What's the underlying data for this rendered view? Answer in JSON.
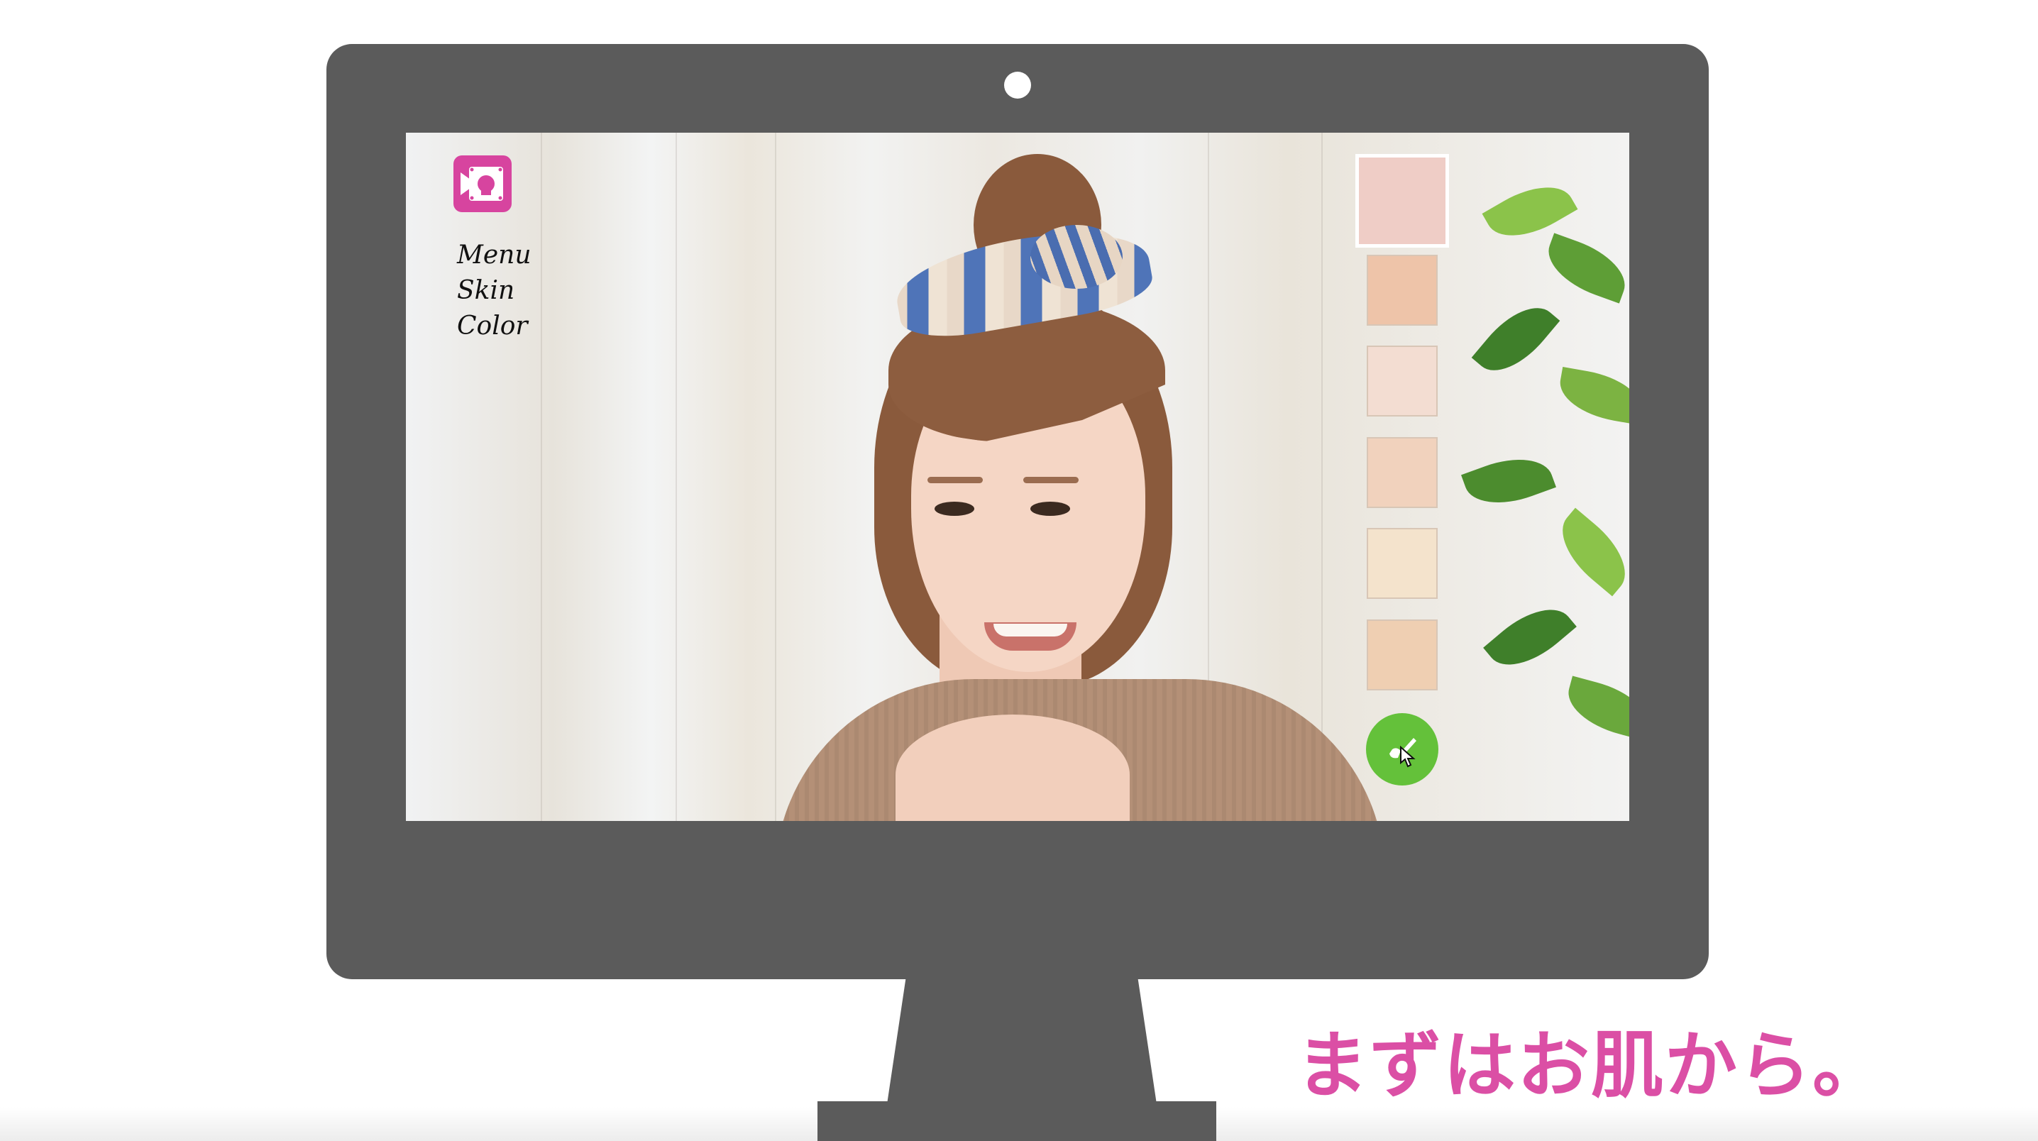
{
  "app": {
    "icon": "video-face-icon",
    "brand_color": "#d7449f"
  },
  "menu": {
    "items": [
      {
        "label": "Menu"
      },
      {
        "label": "Skin"
      },
      {
        "label": "Color"
      }
    ]
  },
  "palette": {
    "swatches": [
      {
        "color": "#efcdc6",
        "selected": true
      },
      {
        "color": "#eec4a9",
        "selected": false
      },
      {
        "color": "#f3ddd2",
        "selected": false
      },
      {
        "color": "#f1d2bd",
        "selected": false
      },
      {
        "color": "#f4e3cc",
        "selected": false
      },
      {
        "color": "#efcfb2",
        "selected": false
      }
    ],
    "apply_button": {
      "icon": "brush-apply-icon",
      "color": "#64c13a"
    }
  },
  "caption": {
    "text": "まずはお肌から。",
    "color": "#db4fa5"
  },
  "monitor": {
    "frame_color": "#5b5b5b"
  }
}
